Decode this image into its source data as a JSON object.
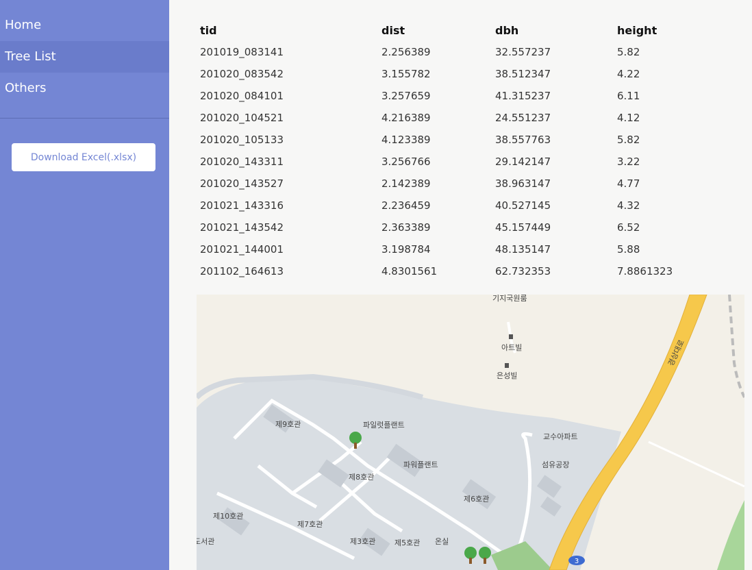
{
  "sidebar": {
    "nav": [
      {
        "label": "Home"
      },
      {
        "label": "Tree List"
      },
      {
        "label": "Others"
      }
    ],
    "download_label": "Download Excel(.xlsx)"
  },
  "table": {
    "headers": [
      "tid",
      "dist",
      "dbh",
      "height"
    ],
    "rows": [
      [
        "201019_083141",
        "2.256389",
        "32.557237",
        "5.82"
      ],
      [
        "201020_083542",
        "3.155782",
        "38.512347",
        "4.22"
      ],
      [
        "201020_084101",
        "3.257659",
        "41.315237",
        "6.11"
      ],
      [
        "201020_104521",
        "4.216389",
        "24.551237",
        "4.12"
      ],
      [
        "201020_105133",
        "4.123389",
        "38.557763",
        "5.82"
      ],
      [
        "201020_143311",
        "3.256766",
        "29.142147",
        "3.22"
      ],
      [
        "201020_143527",
        "2.142389",
        "38.963147",
        "4.77"
      ],
      [
        "201021_143316",
        "2.236459",
        "40.527145",
        "4.32"
      ],
      [
        "201021_143542",
        "2.363389",
        "45.157449",
        "6.52"
      ],
      [
        "201021_144001",
        "3.198784",
        "48.135147",
        "5.88"
      ],
      [
        "201102_164613",
        "4.8301561",
        "62.732353",
        "7.8861323"
      ]
    ]
  },
  "map": {
    "labels": {
      "gijiguk": "기지국원룸",
      "art": "아트빌",
      "eunseong": "은성빌",
      "hall9": "제9호관",
      "pilot": "파일럿플랜트",
      "faculty": "교수아파트",
      "power": "파워플랜트",
      "textile": "섬유공장",
      "hall8": "제8호관",
      "hall6": "제6호관",
      "hall10": "제10호관",
      "hall7": "제7호관",
      "hall3": "제3호관",
      "hall5": "제5호관",
      "greenhouse": "온실",
      "library": "도서관",
      "road": "경상대로",
      "route": "3"
    },
    "tree_icon": "tree-icon"
  }
}
